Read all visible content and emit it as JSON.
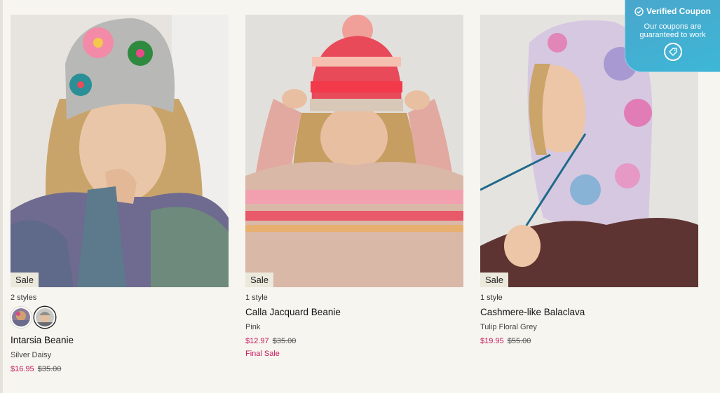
{
  "coupon": {
    "title": "Verified Coupon",
    "subtitle": "Our coupons are guaranteed to work",
    "check_icon": "check-circle-icon",
    "tag_icon": "tag-icon",
    "color": "#41b0d4"
  },
  "products": [
    {
      "badge": "Sale",
      "styles": "2 styles",
      "name": "Intarsia Beanie",
      "color": "Silver Daisy",
      "price": "$16.95",
      "original_price": "$35.00",
      "swatches": [
        "Purple",
        "Silver Daisy"
      ]
    },
    {
      "badge": "Sale",
      "styles": "1 style",
      "name": "Calla Jacquard Beanie",
      "color": "Pink",
      "price": "$12.97",
      "original_price": "$35.00",
      "note": "Final Sale"
    },
    {
      "badge": "Sale",
      "styles": "1 style",
      "name": "Cashmere-like Balaclava",
      "color": "Tulip Floral Grey",
      "price": "$19.95",
      "original_price": "$55.00"
    }
  ],
  "colors": {
    "sale_price": "#c2185b",
    "badge_bg": "#ebe8dc",
    "page_bg": "#f7f5f0"
  }
}
